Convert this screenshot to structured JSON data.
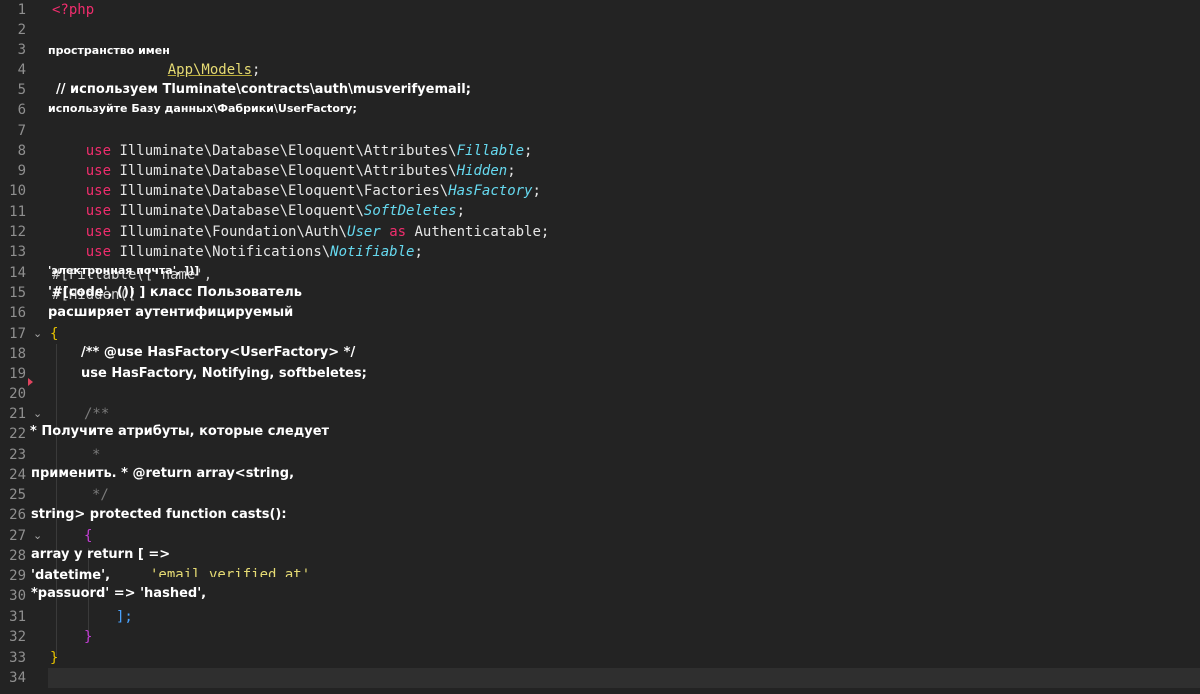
{
  "line_numbers": [
    "1",
    "2",
    "3",
    "4",
    "5",
    "6",
    "7",
    "8",
    "9",
    "10",
    "11",
    "12",
    "13",
    "14",
    "15",
    "16",
    "17",
    "18",
    "19",
    "20",
    "21",
    "22",
    "23",
    "24",
    "25",
    "26",
    "27",
    "28",
    "29",
    "30",
    "31",
    "32",
    "33",
    "34"
  ],
  "fold_symbol": "⌄",
  "code": {
    "l1": "<?php",
    "l3_ns_overlay": "пространство имен",
    "l3_ns_value": "App\\Models",
    "l3_semicolon": ";",
    "l5_overlay": "// используем Tluminate\\contracts\\auth\\musverifyemail;",
    "l6_overlay": "используйте Базу данных\\Фабрики\\UserFactory;",
    "use_kw": "use",
    "as_kw": "as",
    "l7_path": "Illuminate\\Database\\Eloquent\\Attributes\\",
    "l7_cls": "Fillable",
    "l8_path": "Illuminate\\Database\\Eloquent\\Attributes\\",
    "l8_cls": "Hidden",
    "l9_path": "Illuminate\\Database\\Eloquent\\Factories\\",
    "l9_cls": "HasFactory",
    "l10_path": "Illuminate\\Database\\Eloquent\\",
    "l10_cls": "SoftDeletes",
    "l11_path": "Illuminate\\Foundation\\Auth\\",
    "l11_cls": "User",
    "l11_alias": "Authenticatable",
    "l12_path": "Illuminate\\Notifications\\",
    "l12_cls": "Notifiable",
    "semicolon": ";",
    "l14_under": "#[Fillable(['name',",
    "l14_overlay": "'электронная почта', ])]",
    "l15_under": "#[Hidden([",
    "l15_overlay": "'#[code', ()) ] класс Пользователь",
    "l16_overlay": "расширяет аутентифицируемый",
    "l17_brace": "{",
    "l18_overlay": "/** @use HasFactory<UserFactory> */",
    "l19_overlay": "use HasFactory, Notifying, softbeletes;",
    "l21_comment": "/**",
    "l22_overlay": "* Получите атрибуты, которые следует",
    "l23_comment": "*",
    "l24_overlay": "применить. * @return array<string,",
    "l25_comment": "*/",
    "l26_overlay": "string> protected function casts():",
    "l27_brace": "{",
    "l28_overlay": "array у return [ =>",
    "l29_overlay": "'datetime',",
    "l29_string": "'email_verified_at'",
    "l30_overlay": "*passuord' => 'hashed',",
    "l31_close": "];",
    "l32_close": "}",
    "l33_close": "}"
  },
  "colors": {
    "background": "#232323",
    "keyword": "#f02d6d",
    "class_italic": "#66d9ef",
    "string": "#e6db74",
    "line_number": "#8f8f8f",
    "overlay_text": "#ffffff"
  }
}
